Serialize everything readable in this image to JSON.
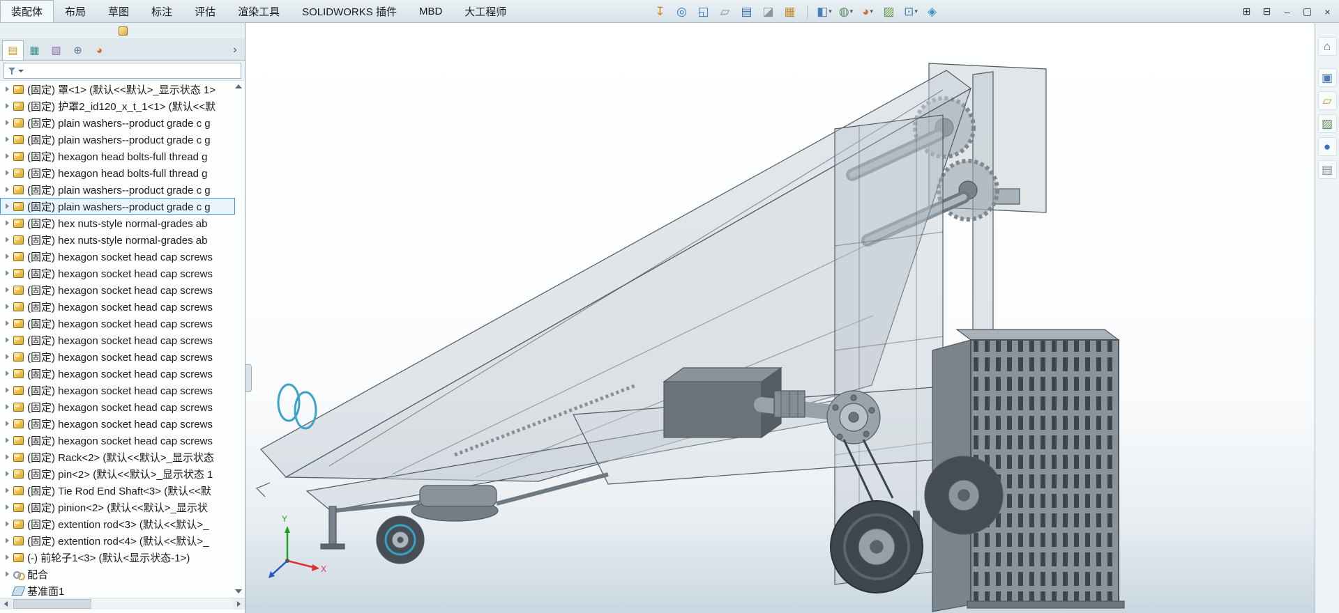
{
  "window": {
    "controls": [
      {
        "name": "toggle-pane-1-button",
        "icon": "toggle-pane-1-icon",
        "glyph": "⊞"
      },
      {
        "name": "toggle-pane-2-button",
        "icon": "toggle-pane-2-icon",
        "glyph": "⊟"
      },
      {
        "name": "minimize-button",
        "icon": "minimize-icon",
        "glyph": "–"
      },
      {
        "name": "restore-button",
        "icon": "restore-icon",
        "glyph": "▢"
      },
      {
        "name": "close-button",
        "icon": "close-icon",
        "glyph": "×"
      }
    ]
  },
  "ribbon": {
    "tabs": [
      {
        "name": "tab-assembly",
        "label": "装配体",
        "active": true
      },
      {
        "name": "tab-layout",
        "label": "布局"
      },
      {
        "name": "tab-sketch",
        "label": "草图"
      },
      {
        "name": "tab-annotate",
        "label": "标注"
      },
      {
        "name": "tab-evaluate",
        "label": "评估"
      },
      {
        "name": "tab-render-tools",
        "label": "渲染工具"
      },
      {
        "name": "tab-solidworks-addins",
        "label": "SOLIDWORKS 插件"
      },
      {
        "name": "tab-mbd",
        "label": "MBD"
      },
      {
        "name": "tab-dagongchengshi",
        "label": "大工程师"
      }
    ],
    "toolbar": [
      {
        "name": "insert-component-button",
        "icon": "insert-component-icon",
        "glyph": "↧",
        "color": "#d9820a"
      },
      {
        "name": "zoom-to-fit-button",
        "icon": "zoom-to-fit-icon",
        "glyph": "◎",
        "color": "#3a7bbf"
      },
      {
        "name": "zoom-to-area-button",
        "icon": "zoom-to-area-icon",
        "glyph": "◱",
        "color": "#3a7bbf"
      },
      {
        "name": "edit-component-button",
        "icon": "edit-component-icon",
        "glyph": "▱",
        "color": "#7f8c96"
      },
      {
        "name": "design-library-button",
        "icon": "design-library-icon",
        "glyph": "▤",
        "color": "#3a6fb0"
      },
      {
        "name": "eraser-button",
        "icon": "eraser-icon",
        "glyph": "◪",
        "color": "#8a949c"
      },
      {
        "name": "sheet-button",
        "icon": "sheet-icon",
        "glyph": "▦",
        "color": "#c28a2e"
      },
      {
        "separator": true
      },
      {
        "name": "view-orientation-button",
        "icon": "view-orientation-icon",
        "glyph": "◧",
        "color": "#4a7fb5",
        "dropdown": "▾"
      },
      {
        "name": "display-style-button",
        "icon": "display-style-icon",
        "glyph": "◍",
        "color": "#5a8a5a",
        "dropdown": "▾"
      },
      {
        "name": "edit-appearance-button",
        "icon": "edit-appearance-icon",
        "glyph": "◕",
        "color": "#d07030",
        "dropdown": "▾"
      },
      {
        "name": "apply-scene-button",
        "icon": "apply-scene-icon",
        "glyph": "▨",
        "color": "#6a9a4a"
      },
      {
        "name": "view-settings-button",
        "icon": "view-settings-icon",
        "glyph": "⊡",
        "color": "#4a7fb5",
        "dropdown": "▾"
      },
      {
        "name": "3d-view-button",
        "icon": "3d-view-icon",
        "glyph": "◈",
        "color": "#3f8fbf"
      }
    ]
  },
  "left_panel": {
    "collapse_glyph": "›",
    "tabs": [
      {
        "name": "featuremanager-tab",
        "icon": "featuremanager-icon",
        "glyph": "▤",
        "color": "#c79a2e",
        "active": true
      },
      {
        "name": "propertymanager-tab",
        "icon": "propertymanager-icon",
        "glyph": "▦",
        "color": "#3f8f8f"
      },
      {
        "name": "configurationmanager-tab",
        "icon": "configurationmanager-icon",
        "glyph": "▧",
        "color": "#8f6fb0"
      },
      {
        "name": "dimxpertmanager-tab",
        "icon": "dimxpertmanager-icon",
        "glyph": "⊕",
        "color": "#5a7a9a"
      },
      {
        "name": "displaymanager-tab",
        "icon": "displaymanager-icon",
        "glyph": "◕",
        "color": "#d0662e"
      }
    ],
    "tree": {
      "items": [
        {
          "label": "(固定) 罩<1> (默认<<默认>_显示状态 1>"
        },
        {
          "label": "(固定) 护罩2_id120_x_t_1<1> (默认<<默"
        },
        {
          "label": "(固定) plain washers--product grade c g"
        },
        {
          "label": "(固定) plain washers--product grade c g"
        },
        {
          "label": "(固定) hexagon head bolts-full thread g"
        },
        {
          "label": "(固定) hexagon head bolts-full thread g"
        },
        {
          "label": "(固定) plain washers--product grade c g"
        },
        {
          "label": "(固定) plain washers--product grade c g",
          "selected": true
        },
        {
          "label": "(固定) hex nuts-style normal-grades ab"
        },
        {
          "label": "(固定) hex nuts-style normal-grades ab"
        },
        {
          "label": "(固定) hexagon socket head cap screws"
        },
        {
          "label": "(固定) hexagon socket head cap screws"
        },
        {
          "label": "(固定) hexagon socket head cap screws"
        },
        {
          "label": "(固定) hexagon socket head cap screws"
        },
        {
          "label": "(固定) hexagon socket head cap screws"
        },
        {
          "label": "(固定) hexagon socket head cap screws"
        },
        {
          "label": "(固定) hexagon socket head cap screws"
        },
        {
          "label": "(固定) hexagon socket head cap screws"
        },
        {
          "label": "(固定) hexagon socket head cap screws"
        },
        {
          "label": "(固定) hexagon socket head cap screws"
        },
        {
          "label": "(固定) hexagon socket head cap screws"
        },
        {
          "label": "(固定) hexagon socket head cap screws"
        },
        {
          "label": "(固定) Rack<2> (默认<<默认>_显示状态"
        },
        {
          "label": "(固定) pin<2> (默认<<默认>_显示状态 1"
        },
        {
          "label": "(固定) Tie Rod End Shaft<3> (默认<<默"
        },
        {
          "label": "(固定) pinion<2> (默认<<默认>_显示状"
        },
        {
          "label": "(固定) extention rod<3> (默认<<默认>_"
        },
        {
          "label": "(固定) extention rod<4> (默认<<默认>_"
        },
        {
          "label": "(-) 前轮子1<3> (默认<显示状态-1>)"
        },
        {
          "label": "配合",
          "type": "mates"
        },
        {
          "label": "基准面1",
          "type": "plane"
        }
      ]
    }
  },
  "viewport": {
    "triad": {
      "x": "X",
      "y": "Y"
    }
  },
  "task_pane": {
    "icons": [
      {
        "name": "home-button",
        "icon": "home-icon",
        "glyph": "⌂",
        "color": "#4a6f9a"
      },
      {
        "name": "design-library-pane-button",
        "icon": "design-library-pane-icon",
        "glyph": "▣",
        "color": "#4a7fb5"
      },
      {
        "name": "file-explorer-button",
        "icon": "file-explorer-icon",
        "glyph": "▱",
        "color": "#c79a2e"
      },
      {
        "name": "appearances-button",
        "icon": "appearances-icon",
        "glyph": "▨",
        "color": "#5a8a5a"
      },
      {
        "name": "scenes-button",
        "icon": "scenes-icon",
        "glyph": "●",
        "color": "#3f6fbf"
      },
      {
        "name": "custom-properties-button",
        "icon": "custom-properties-icon",
        "glyph": "▤",
        "color": "#7f8c96"
      }
    ]
  }
}
